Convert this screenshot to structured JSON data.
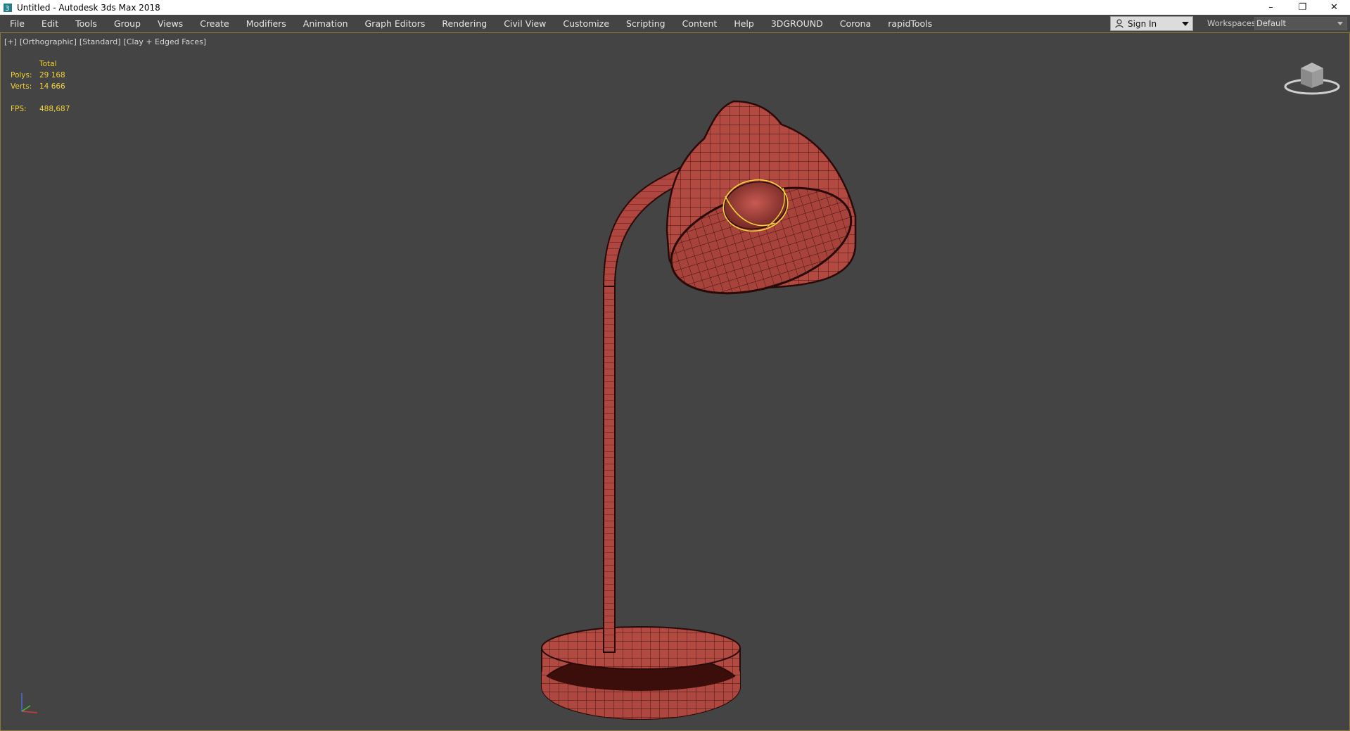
{
  "title_bar": {
    "title": "Untitled - Autodesk 3ds Max 2018",
    "minimize": "–",
    "restore": "❐",
    "close": "✕"
  },
  "menu": {
    "items": [
      "File",
      "Edit",
      "Tools",
      "Group",
      "Views",
      "Create",
      "Modifiers",
      "Animation",
      "Graph Editors",
      "Rendering",
      "Civil View",
      "Customize",
      "Scripting",
      "Content",
      "Help",
      "3DGROUND",
      "Corona",
      "rapidTools"
    ],
    "sign_in": "Sign In",
    "workspaces_label": "Workspaces:",
    "workspace_value": "Default"
  },
  "viewport": {
    "label_plus": "[+]",
    "label_view": "[Orthographic]",
    "label_shading_std": "[Standard]",
    "label_shading": "[Clay + Edged Faces]",
    "stats": {
      "header": "Total",
      "polys_label": "Polys:",
      "polys_value": "29 168",
      "verts_label": "Verts:",
      "verts_value": "14 666",
      "fps_label": "FPS:",
      "fps_value": "488,687"
    }
  },
  "colors": {
    "viewport_bg": "#444444",
    "model_clay": "#b34a42",
    "model_edge": "#3a0f0c",
    "selection": "#f2d33a",
    "stats_text": "#f2d33a",
    "active_border": "#8a7a35"
  }
}
